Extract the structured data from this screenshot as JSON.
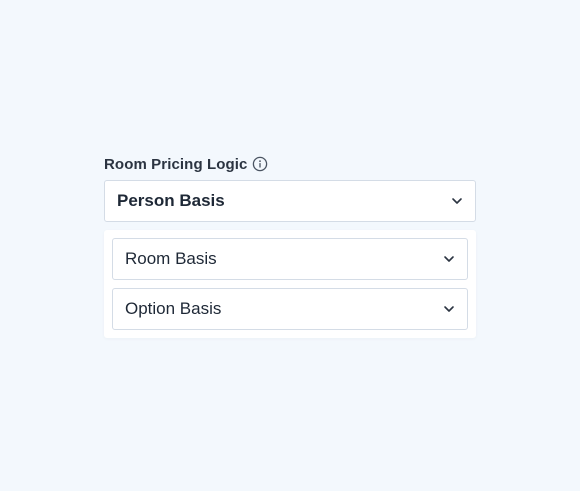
{
  "field": {
    "label": "Room Pricing Logic",
    "info_icon": "info-circle-icon"
  },
  "select": {
    "selected_value": "Person Basis",
    "expanded": true,
    "chevron_icon": "chevron-down-icon"
  },
  "options": [
    {
      "label": "Room Basis"
    },
    {
      "label": "Option Basis"
    }
  ],
  "colors": {
    "background": "#f3f8fd",
    "border": "#d4dce6",
    "text": "#1e2836",
    "icon": "#4a5462"
  }
}
